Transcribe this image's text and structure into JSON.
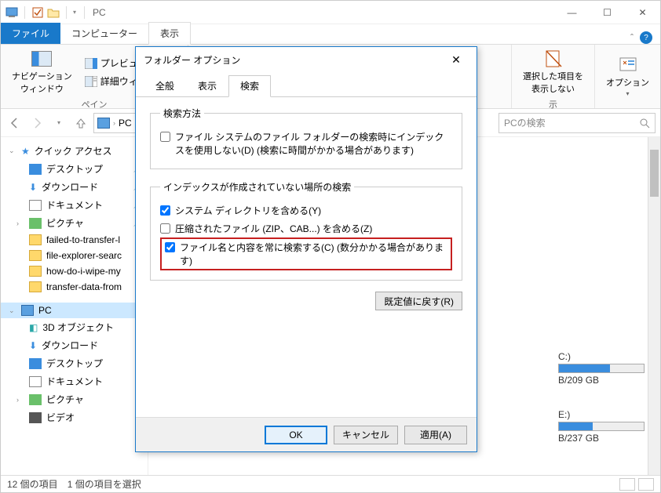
{
  "window": {
    "title": "PC",
    "min": "—",
    "max": "☐",
    "close": "✕"
  },
  "ribtabs": {
    "file": "ファイル",
    "computer": "コンピューター",
    "view": "表示"
  },
  "ribbon": {
    "navpane": "ナビゲーション\nウィンドウ",
    "preview": "プレビュー ウィン",
    "details": "詳細ウィンド",
    "panes_label": "ペイン",
    "display_label": "示",
    "hide_selected": "選択した項目を\n表示しない",
    "options": "オプション"
  },
  "nav": {
    "pc": "PC",
    "search_placeholder": "PCの検索"
  },
  "tree": {
    "quick_access": "クイック アクセス",
    "desktop": "デスクトップ",
    "downloads": "ダウンロード",
    "documents": "ドキュメント",
    "pictures": "ピクチャ",
    "f1": "failed-to-transfer-l",
    "f2": "file-explorer-searc",
    "f3": "how-do-i-wipe-my",
    "f4": "transfer-data-from",
    "pc": "PC",
    "objects3d": "3D オブジェクト",
    "downloads2": "ダウンロード",
    "desktop2": "デスクトップ",
    "documents2": "ドキュメント",
    "pictures2": "ピクチャ",
    "videos": "ビデオ"
  },
  "drives": {
    "c_label": "C:)",
    "c_size": "B/209 GB",
    "e_label": "E:)",
    "e_size": "B/237 GB"
  },
  "status": {
    "items": "12 個の項目",
    "selected": "1 個の項目を選択"
  },
  "dialog": {
    "title": "フォルダー オプション",
    "tabs": {
      "general": "全般",
      "view": "表示",
      "search": "検索"
    },
    "group1": {
      "legend": "検索方法",
      "opt1": "ファイル システムのファイル フォルダーの検索時にインデックスを使用しない(D) (検索に時間がかかる場合があります)"
    },
    "group2": {
      "legend": "インデックスが作成されていない場所の検索",
      "opt1": "システム ディレクトリを含める(Y)",
      "opt2": "圧縮されたファイル (ZIP、CAB...) を含める(Z)",
      "opt3": "ファイル名と内容を常に検索する(C) (数分かかる場合があります)"
    },
    "reset": "既定値に戻す(R)",
    "ok": "OK",
    "cancel": "キャンセル",
    "apply": "適用(A)"
  }
}
